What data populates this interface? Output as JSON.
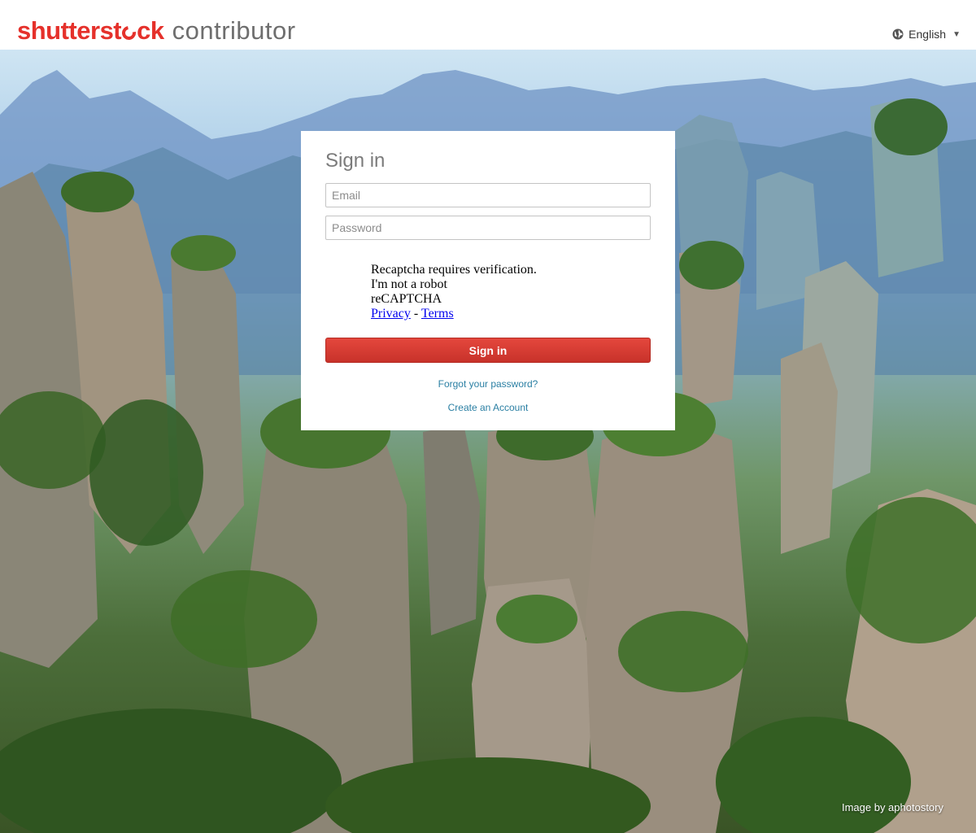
{
  "header": {
    "brand": "shutterst",
    "brand_end": "ck",
    "product": "contributor",
    "language": "English"
  },
  "signin": {
    "title": "Sign in",
    "email_placeholder": "Email",
    "password_placeholder": "Password",
    "recaptcha": {
      "line1": "Recaptcha requires verification.",
      "line2": "I'm not a robot",
      "line3": "reCAPTCHA",
      "privacy": "Privacy",
      "separator": " - ",
      "terms": "Terms"
    },
    "button_label": "Sign in",
    "forgot_link": "Forgot your password?",
    "create_link": "Create an Account"
  },
  "background": {
    "credit": "Image by aphotostory"
  },
  "colors": {
    "brand_red": "#e5312b",
    "button_red": "#d33a31",
    "link_blue": "#2a7fa3"
  }
}
